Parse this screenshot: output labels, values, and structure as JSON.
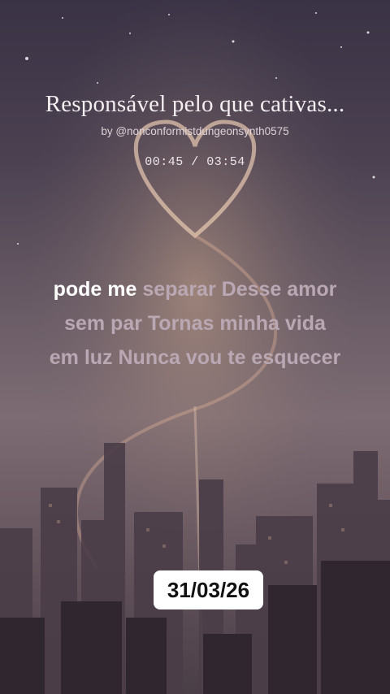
{
  "song": {
    "title": "Responsável pelo que cativas...",
    "byline": "by @nonconformistdungeonsynth0575",
    "time": "00:45 / 03:54"
  },
  "lyrics": {
    "sung": "pode me",
    "rest_line1": "separar Desse amor",
    "line2": "sem par Tornas minha vida",
    "line3": "em luz Nunca vou te esquecer"
  },
  "badge": {
    "date": "31/03/26"
  },
  "background": {
    "description_icon": "city-skyline-heart-illustration"
  }
}
